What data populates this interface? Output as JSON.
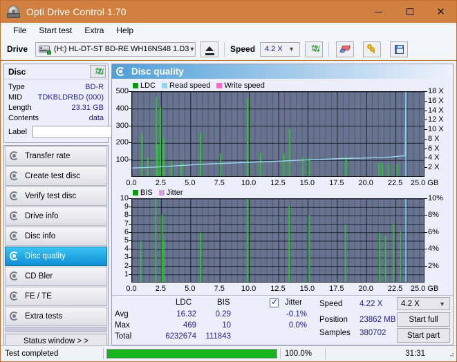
{
  "window": {
    "title": "Opti Drive Control 1.70",
    "icon": "disc-drive-icon",
    "minimize": "–",
    "maximize": "□",
    "close": "✕"
  },
  "menu": {
    "items": [
      {
        "label": "File"
      },
      {
        "label": "Start test"
      },
      {
        "label": "Extra"
      },
      {
        "label": "Help"
      }
    ]
  },
  "toolbar": {
    "drive_label": "Drive",
    "drive_value": "(H:)   HL-DT-ST BD-RE  WH16NS48 1.D3",
    "eject_icon": "eject-icon",
    "speed_label": "Speed",
    "speed_value": "4.2 X",
    "refresh_icon": "refresh-icon",
    "eraser_icon": "eraser-icon",
    "keys_icon": "keys-icon",
    "save_icon": "floppy-save-icon"
  },
  "disc_panel": {
    "title": "Disc",
    "refresh_icon": "refresh-icon",
    "rows": [
      {
        "key": "Type",
        "value": "BD-R"
      },
      {
        "key": "MID",
        "value": "TDKBLDRBD (000)"
      },
      {
        "key": "Length",
        "value": "23.31 GB"
      },
      {
        "key": "Contents",
        "value": "data"
      }
    ],
    "label_key": "Label",
    "label_value": "",
    "label_placeholder": "",
    "cd_icon": "cd-disc-icon"
  },
  "nav": {
    "items": [
      {
        "label": "Transfer rate",
        "active": false
      },
      {
        "label": "Create test disc",
        "active": false
      },
      {
        "label": "Verify test disc",
        "active": false
      },
      {
        "label": "Drive info",
        "active": false
      },
      {
        "label": "Disc info",
        "active": false
      },
      {
        "label": "Disc quality",
        "active": true
      },
      {
        "label": "CD Bler",
        "active": false
      },
      {
        "label": "FE / TE",
        "active": false
      },
      {
        "label": "Extra tests",
        "active": false
      }
    ],
    "status_button": "Status window > >"
  },
  "content": {
    "header_title": "Disc quality",
    "header_icon": "disc-quality-icon"
  },
  "chart_data": [
    {
      "type": "line",
      "name": "ldc-chart",
      "title": "",
      "xlabel": "GB",
      "ylabel": "",
      "legend": [
        {
          "label": "LDC",
          "color": "#00a000"
        },
        {
          "label": "Read speed",
          "color": "#8fd4f5"
        },
        {
          "label": "Write speed",
          "color": "#ff66cc"
        }
      ],
      "legend_position": "top-left",
      "grid": true,
      "xlim": [
        0,
        25.0
      ],
      "xticks": [
        0.0,
        2.5,
        5.0,
        7.5,
        10.0,
        12.5,
        15.0,
        17.5,
        20.0,
        22.5,
        25.0
      ],
      "xticklabels": [
        "0.0",
        "2.5",
        "5.0",
        "7.5",
        "10.0",
        "12.5",
        "15.0",
        "17.5",
        "20.0",
        "22.5",
        "25.0"
      ],
      "x_unit": "GB",
      "ylim": [
        0,
        500
      ],
      "yticks": [
        100,
        200,
        300,
        400,
        500
      ],
      "yticklabels": [
        "100",
        "200",
        "300",
        "400",
        "500"
      ],
      "y2lim": [
        0,
        18
      ],
      "y2ticks": [
        2,
        4,
        6,
        8,
        10,
        12,
        14,
        16,
        18
      ],
      "y2ticklabels": [
        "2 X",
        "4 X",
        "6 X",
        "8 X",
        "10 X",
        "12 X",
        "14 X",
        "16 X",
        "18 X"
      ],
      "series": [
        {
          "name": "LDC",
          "color": "#00c000",
          "type": "area-spikes",
          "baseline": [
            22,
            20,
            26,
            24,
            21,
            30,
            24,
            22,
            27,
            25,
            23,
            28,
            22,
            26,
            24,
            21,
            25,
            23,
            27,
            22,
            24,
            26,
            21,
            23,
            25,
            22,
            24,
            23,
            26,
            22,
            25,
            23,
            21,
            24,
            27,
            23,
            22,
            25,
            24,
            26,
            22,
            23,
            25,
            21,
            24,
            23,
            26,
            22,
            24,
            25,
            23,
            22,
            26,
            24,
            21,
            25,
            23,
            22,
            27,
            24,
            23,
            25,
            22,
            26,
            24,
            23,
            21,
            25,
            24,
            22,
            26,
            23,
            25,
            24,
            22,
            26,
            23,
            25,
            22,
            24,
            27,
            23,
            25,
            22,
            26,
            24,
            23,
            25,
            27,
            24,
            26,
            23,
            25,
            28,
            26,
            24,
            27,
            25,
            29,
            26,
            28,
            25,
            30,
            27,
            29,
            26,
            31,
            28,
            30,
            27,
            32,
            29,
            31,
            28,
            33,
            30,
            32,
            29,
            34,
            31,
            33,
            30,
            35,
            32,
            34,
            31,
            36,
            33,
            35,
            32,
            37,
            34,
            36,
            33,
            38,
            35,
            37,
            34,
            39,
            36,
            38,
            35,
            40,
            37,
            39,
            36,
            41,
            38,
            40,
            37,
            42,
            39,
            41,
            38,
            43,
            40,
            42,
            39,
            44,
            41,
            43,
            40,
            45,
            42,
            44,
            41,
            46,
            43,
            45,
            42,
            47,
            44,
            46,
            43,
            48,
            45,
            47,
            44,
            49,
            46,
            48,
            45,
            50,
            47,
            49,
            46,
            51,
            48,
            50,
            47,
            52,
            49,
            51,
            48,
            53,
            50,
            52,
            49,
            54,
            51
          ],
          "spikes": [
            {
              "x": 0.85,
              "y": 258
            },
            {
              "x": 1.35,
              "y": 118
            },
            {
              "x": 2.05,
              "y": 470
            },
            {
              "x": 2.18,
              "y": 193
            },
            {
              "x": 2.42,
              "y": 414
            },
            {
              "x": 2.7,
              "y": 228
            },
            {
              "x": 3.35,
              "y": 96
            },
            {
              "x": 4.2,
              "y": 88
            },
            {
              "x": 5.85,
              "y": 262
            },
            {
              "x": 7.55,
              "y": 141
            },
            {
              "x": 9.85,
              "y": 463
            },
            {
              "x": 10.95,
              "y": 143
            },
            {
              "x": 12.95,
              "y": 143
            },
            {
              "x": 13.45,
              "y": 285
            },
            {
              "x": 14.55,
              "y": 120
            },
            {
              "x": 15.1,
              "y": 117
            },
            {
              "x": 18.25,
              "y": 120
            },
            {
              "x": 21.05,
              "y": 87
            },
            {
              "x": 21.35,
              "y": 82
            },
            {
              "x": 21.9,
              "y": 79
            },
            {
              "x": 22.6,
              "y": 78
            }
          ]
        },
        {
          "name": "Read speed",
          "color": "#9ddcf7",
          "type": "step-line",
          "points": [
            {
              "x": 0.0,
              "y": 2.0
            },
            {
              "x": 2.0,
              "y": 2.2
            },
            {
              "x": 4.0,
              "y": 2.5
            },
            {
              "x": 6.0,
              "y": 2.8
            },
            {
              "x": 8.0,
              "y": 3.0
            },
            {
              "x": 10.0,
              "y": 3.2
            },
            {
              "x": 12.0,
              "y": 3.4
            },
            {
              "x": 14.0,
              "y": 3.6
            },
            {
              "x": 16.0,
              "y": 3.8
            },
            {
              "x": 18.0,
              "y": 4.0
            },
            {
              "x": 20.0,
              "y": 4.1
            },
            {
              "x": 22.0,
              "y": 4.3
            },
            {
              "x": 23.3,
              "y": 4.6
            },
            {
              "x": 23.35,
              "y": 18.0
            }
          ]
        }
      ]
    },
    {
      "type": "line",
      "name": "bis-jitter-chart",
      "title": "",
      "xlabel": "GB",
      "legend": [
        {
          "label": "BIS",
          "color": "#00a000"
        },
        {
          "label": "Jitter",
          "color": "#d0a0d8"
        }
      ],
      "legend_position": "top-left",
      "grid": true,
      "xlim": [
        0,
        25.0
      ],
      "xticks": [
        0.0,
        2.5,
        5.0,
        7.5,
        10.0,
        12.5,
        15.0,
        17.5,
        20.0,
        22.5,
        25.0
      ],
      "xticklabels": [
        "0.0",
        "2.5",
        "5.0",
        "7.5",
        "10.0",
        "12.5",
        "15.0",
        "17.5",
        "20.0",
        "22.5",
        "25.0"
      ],
      "x_unit": "GB",
      "ylim": [
        0,
        10
      ],
      "yticks": [
        1,
        2,
        3,
        4,
        5,
        6,
        7,
        8,
        9,
        10
      ],
      "yticklabels": [
        "1",
        "2",
        "3",
        "4",
        "5",
        "6",
        "7",
        "8",
        "9",
        "10"
      ],
      "y2lim": [
        0,
        10
      ],
      "y2ticks": [
        2,
        4,
        6,
        8,
        10
      ],
      "y2ticklabels": [
        "2%",
        "4%",
        "6%",
        "8%",
        "10%"
      ],
      "series": [
        {
          "name": "BIS",
          "color": "#00c000",
          "type": "area-spikes",
          "baseline_low": 2.0,
          "baseline_mid": 2.9,
          "ramp_end": 4.3,
          "spikes": [
            {
              "x": 0.75,
              "y": 5.0
            },
            {
              "x": 2.02,
              "y": 10.0
            },
            {
              "x": 2.55,
              "y": 8.1
            },
            {
              "x": 2.72,
              "y": 5.1
            },
            {
              "x": 5.85,
              "y": 6.0
            },
            {
              "x": 9.85,
              "y": 10.0
            },
            {
              "x": 13.4,
              "y": 9.2
            },
            {
              "x": 15.1,
              "y": 8.1
            },
            {
              "x": 18.2,
              "y": 7.0
            },
            {
              "x": 21.1,
              "y": 6.0
            },
            {
              "x": 21.6,
              "y": 5.6
            },
            {
              "x": 22.3,
              "y": 7.1
            },
            {
              "x": 22.9,
              "y": 6.3
            }
          ]
        },
        {
          "name": "Jitter",
          "color": "#cfa8d8",
          "type": "band"
        }
      ]
    }
  ],
  "stats": {
    "col_headers": [
      "LDC",
      "BIS"
    ],
    "row_labels": [
      "Avg",
      "Max",
      "Total"
    ],
    "ldc": {
      "avg": "16.32",
      "max": "469",
      "total": "6232674"
    },
    "bis": {
      "avg": "0.29",
      "max": "10",
      "total": "111843"
    },
    "jitter": {
      "checkbox_label": "Jitter",
      "checked": true,
      "avg": "-0.1%",
      "max": "0.0%"
    },
    "speed_label": "Speed",
    "speed_value": "4.22 X",
    "position_label": "Position",
    "position_value": "23862 MB",
    "samples_label": "Samples",
    "samples_value": "380702",
    "speed_select_value": "4.2 X",
    "start_full_button": "Start full",
    "start_part_button": "Start part"
  },
  "statusbar": {
    "message": "Test completed",
    "progress_percent": 100.0,
    "progress_text": "100.0%",
    "elapsed": "31:31"
  }
}
